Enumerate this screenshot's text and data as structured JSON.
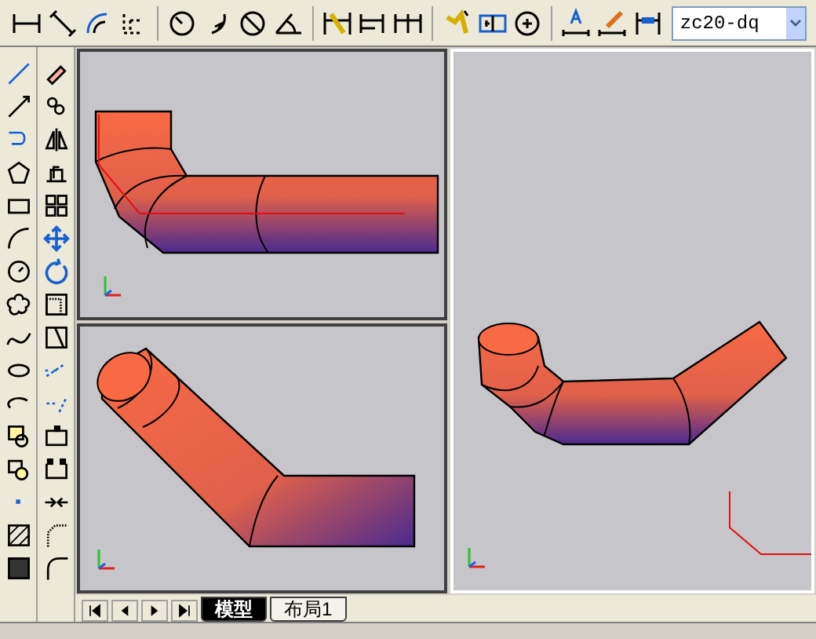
{
  "dimension_toolbar": {
    "dimension_style": "zc20-dq"
  },
  "layout_tabs": [
    {
      "label": "模型",
      "selected": true
    },
    {
      "label": "布局1",
      "selected": false
    }
  ]
}
